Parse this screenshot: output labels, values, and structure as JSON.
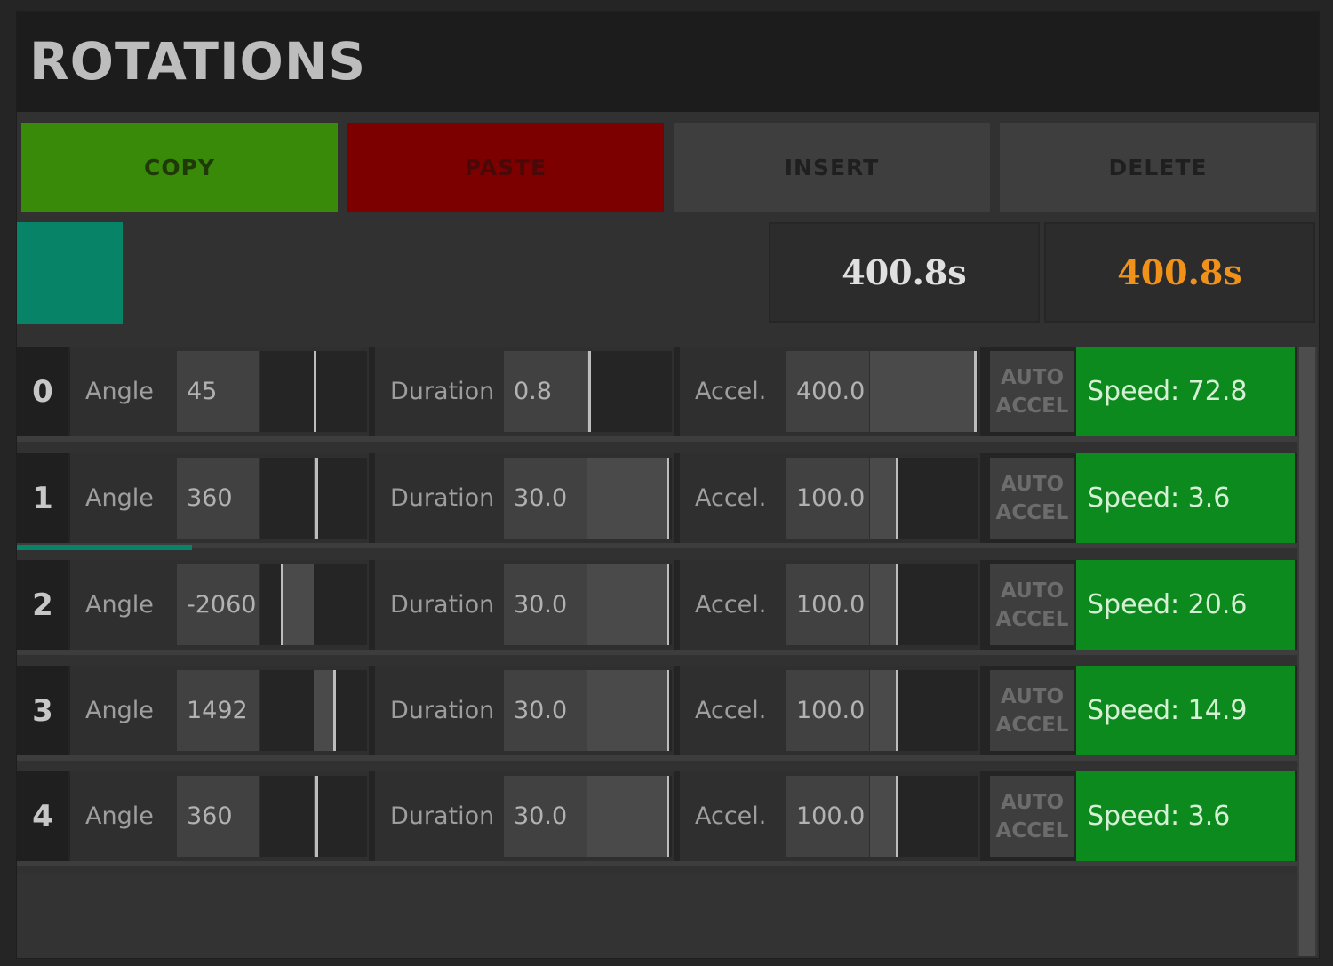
{
  "title": "ROTATIONS",
  "toolbar": {
    "copy_label": "COPY",
    "paste_label": "PASTE",
    "insert_label": "INSERT",
    "delete_label": "DELETE"
  },
  "colors": {
    "copy": "#3a8a0a",
    "paste": "#7d0000",
    "swatch": "#078468",
    "speed": "#0d8a1d",
    "time_current": "#f0921a"
  },
  "times": {
    "total": "400.8s",
    "current": "400.8s"
  },
  "labels": {
    "angle": "Angle",
    "duration": "Duration",
    "accel": "Accel.",
    "auto_line1": "AUTO",
    "auto_line2": "ACCEL"
  },
  "rows": [
    {
      "index": "0",
      "angle": "45",
      "duration": "0.8",
      "accel": "400.0",
      "speed": "Speed: 72.8"
    },
    {
      "index": "1",
      "angle": "360",
      "duration": "30.0",
      "accel": "100.0",
      "speed": "Speed: 3.6"
    },
    {
      "index": "2",
      "angle": "-2060",
      "duration": "30.0",
      "accel": "100.0",
      "speed": "Speed: 20.6"
    },
    {
      "index": "3",
      "angle": "1492",
      "duration": "30.0",
      "accel": "100.0",
      "speed": "Speed: 14.9"
    },
    {
      "index": "4",
      "angle": "360",
      "duration": "30.0",
      "accel": "100.0",
      "speed": "Speed: 3.6"
    }
  ]
}
